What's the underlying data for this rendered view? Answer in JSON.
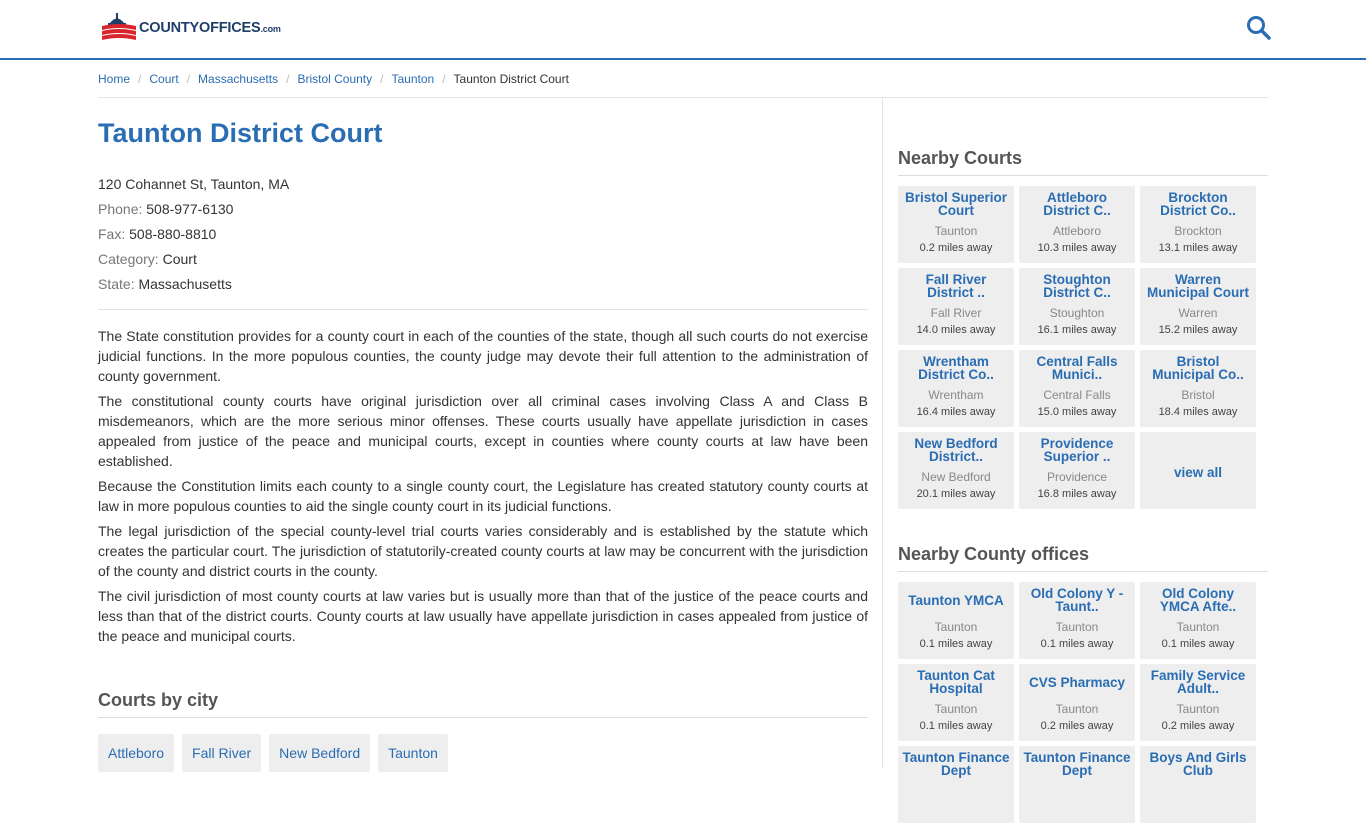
{
  "logo": {
    "part1": "COUNTY",
    "part2": "OFFICES",
    "part3": ".com"
  },
  "breadcrumb": [
    {
      "label": "Home"
    },
    {
      "label": "Court"
    },
    {
      "label": "Massachusetts"
    },
    {
      "label": "Bristol County"
    },
    {
      "label": "Taunton"
    }
  ],
  "breadcrumb_current": "Taunton District Court",
  "page": {
    "title": "Taunton District Court",
    "address": "120 Cohannet St, Taunton, MA",
    "phone_label": "Phone:",
    "phone": "508-977-6130",
    "fax_label": "Fax:",
    "fax": "508-880-8810",
    "category_label": "Category:",
    "category": "Court",
    "state_label": "State:",
    "state": "Massachusetts"
  },
  "description": [
    "The State constitution provides for a county court in each of the counties of the state, though all such courts do not exercise judicial functions. In the more populous counties, the county judge may devote their full attention to the administration of county government.",
    "The constitutional county courts have original jurisdiction over all criminal cases involving Class A and Class B misdemeanors, which are the more serious minor offenses. These courts usually have appellate jurisdiction in cases appealed from justice of the peace and municipal courts, except in counties where county courts at law have been established.",
    "Because the Constitution limits each county to a single county court, the Legislature has created statutory county courts at law in more populous counties to aid the single county court in its judicial functions.",
    "The legal jurisdiction of the special county-level trial courts varies considerably and is established by the statute which creates the particular court. The jurisdiction of statutorily-created county courts at law may be concurrent with the jurisdiction of the county and district courts in the county.",
    "The civil jurisdiction of most county courts at law varies but is usually more than that of the justice of the peace courts and less than that of the district courts. County courts at law usually have appellate jurisdiction in cases appealed from justice of the peace and municipal courts."
  ],
  "courts_by_city": {
    "heading": "Courts by city",
    "cities": [
      "Attleboro",
      "Fall River",
      "New Bedford",
      "Taunton"
    ]
  },
  "nearby_courts": {
    "heading": "Nearby Courts",
    "view_all": "view all",
    "items": [
      {
        "name": "Bristol Superior Court",
        "city": "Taunton",
        "dist": "0.2 miles away"
      },
      {
        "name": "Attleboro District C..",
        "city": "Attleboro",
        "dist": "10.3 miles away"
      },
      {
        "name": "Brockton District Co..",
        "city": "Brockton",
        "dist": "13.1 miles away"
      },
      {
        "name": "Fall River District ..",
        "city": "Fall River",
        "dist": "14.0 miles away"
      },
      {
        "name": "Stoughton District C..",
        "city": "Stoughton",
        "dist": "16.1 miles away"
      },
      {
        "name": "Warren Municipal Court",
        "city": "Warren",
        "dist": "15.2 miles away"
      },
      {
        "name": "Wrentham District Co..",
        "city": "Wrentham",
        "dist": "16.4 miles away"
      },
      {
        "name": "Central Falls Munici..",
        "city": "Central Falls",
        "dist": "15.0 miles away"
      },
      {
        "name": "Bristol Municipal Co..",
        "city": "Bristol",
        "dist": "18.4 miles away"
      },
      {
        "name": "New Bedford District..",
        "city": "New Bedford",
        "dist": "20.1 miles away"
      },
      {
        "name": "Providence Superior ..",
        "city": "Providence",
        "dist": "16.8 miles away"
      }
    ]
  },
  "nearby_offices": {
    "heading": "Nearby County offices",
    "items": [
      {
        "name": "Taunton YMCA",
        "city": "Taunton",
        "dist": "0.1 miles away"
      },
      {
        "name": "Old Colony Y - Taunt..",
        "city": "Taunton",
        "dist": "0.1 miles away"
      },
      {
        "name": "Old Colony YMCA Afte..",
        "city": "Taunton",
        "dist": "0.1 miles away"
      },
      {
        "name": "Taunton Cat Hospital",
        "city": "Taunton",
        "dist": "0.1 miles away"
      },
      {
        "name": "CVS Pharmacy",
        "city": "Taunton",
        "dist": "0.2 miles away"
      },
      {
        "name": "Family Service Adult..",
        "city": "Taunton",
        "dist": "0.2 miles away"
      },
      {
        "name": "Taunton Finance Dept",
        "city": "",
        "dist": ""
      },
      {
        "name": "Taunton Finance Dept",
        "city": "",
        "dist": ""
      },
      {
        "name": "Boys And Girls Club",
        "city": "",
        "dist": ""
      }
    ]
  },
  "colors": {
    "brand": "#2a6db3",
    "logo_red": "#d9262c",
    "logo_navy": "#1f3e68"
  },
  "icons": {
    "search": "search-icon",
    "logo": "capitol-flag-icon"
  }
}
